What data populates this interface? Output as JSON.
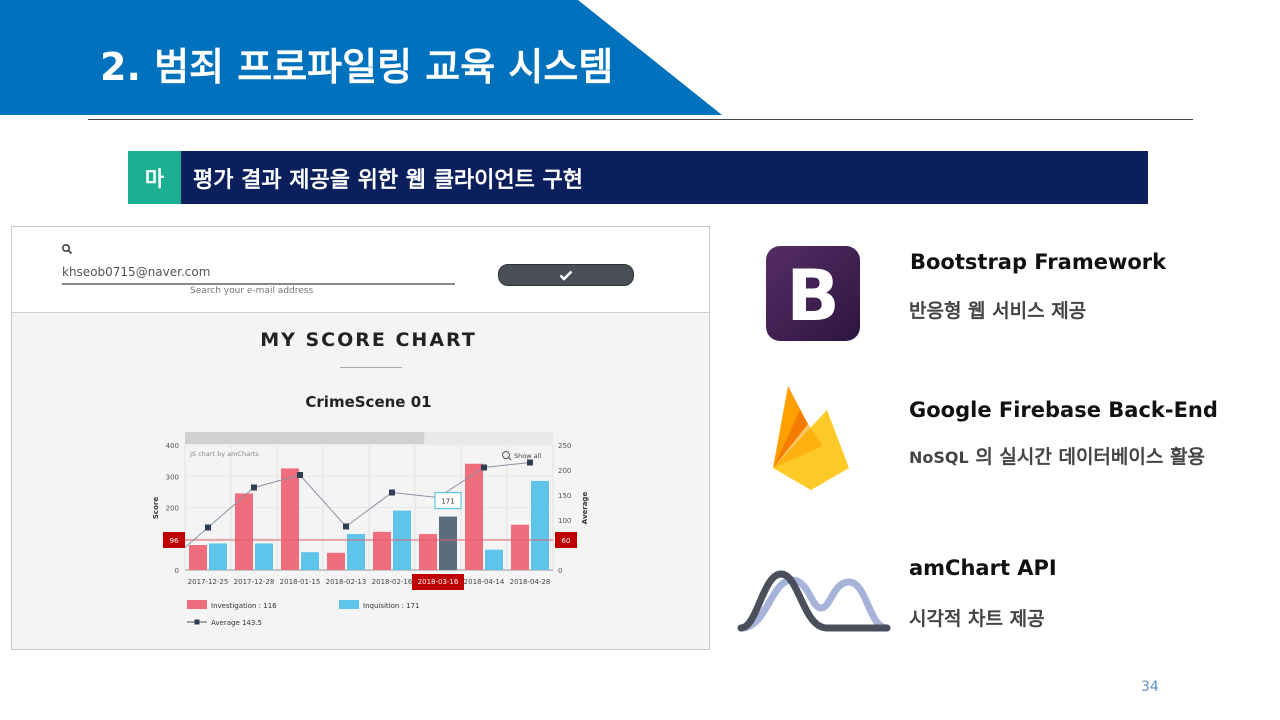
{
  "slide": {
    "title": "2. 범죄 프로파일링 교육 시스템",
    "page_number": "34",
    "colors": {
      "banner": "#0071bc",
      "section_tag": "#1aaf91",
      "section_bar": "#0a1f5c"
    }
  },
  "section": {
    "tag": "마",
    "title": "평가 결과 제공을 위한 웹 클라이언트 구현"
  },
  "screenshot": {
    "search": {
      "value": "khseob0715@naver.com",
      "hint": "Search your e-mail address"
    },
    "heading": "MY SCORE CHART",
    "subheading": "CrimeScene 01"
  },
  "chart_data": {
    "type": "bar",
    "watermark": "JS chart by amCharts",
    "show_all_label": "Show all",
    "ylabel": "Score",
    "y2label": "Average",
    "ylim": [
      0,
      400
    ],
    "y2lim": [
      0,
      250
    ],
    "yticks": [
      "400",
      "300",
      "200",
      "100",
      "0"
    ],
    "y2ticks": [
      "250",
      "200",
      "150",
      "100",
      "50",
      "0"
    ],
    "categories": [
      "2017-12-25",
      "2017-12-28",
      "2018-01-15",
      "2018-02-13",
      "2018-02-16",
      "2018-03-16",
      "2018-04-14",
      "2018-04-28"
    ],
    "highlighted_category": "2018-03-16",
    "series": [
      {
        "name": "Investigation",
        "color": "#f06d7e",
        "values": [
          80,
          245,
          325,
          55,
          122,
          115,
          340,
          145
        ]
      },
      {
        "name": "Inquisition",
        "color": "#5ec4ea",
        "values": [
          85,
          85,
          57,
          115,
          190,
          171,
          65,
          285
        ]
      },
      {
        "name": "Average",
        "color": "#555f70",
        "values": [
          85,
          165,
          190,
          87,
          155,
          145,
          205,
          215
        ]
      }
    ],
    "guide_left": "96",
    "guide_right": "60",
    "tooltip": "171",
    "legend": [
      {
        "label": "Investigation : 116"
      },
      {
        "label": "Inquisition : 171"
      },
      {
        "label": "Average  143.5"
      }
    ]
  },
  "tech": [
    {
      "name": "Bootstrap Framework",
      "desc": "반응형 웹 서비스 제공",
      "icon": "bootstrap-logo"
    },
    {
      "name": "Google Firebase Back-End",
      "desc_prefix": "NoSQL",
      "desc": " 의 실시간 데이터베이스 활용",
      "icon": "firebase-logo"
    },
    {
      "name": "amChart API",
      "desc": "시각적 차트 제공",
      "icon": "amcharts-logo"
    }
  ]
}
